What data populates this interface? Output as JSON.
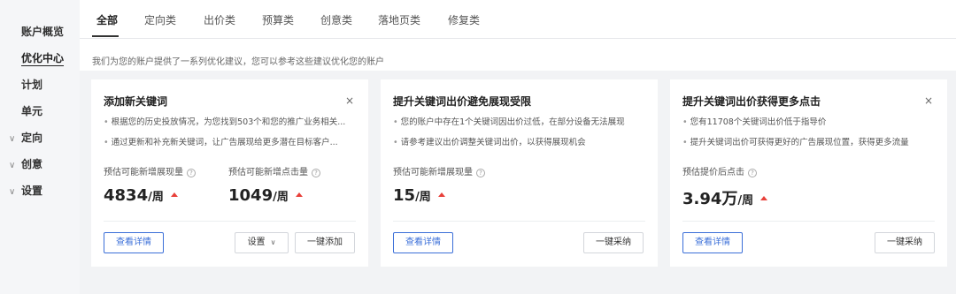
{
  "sidebar": {
    "items": [
      {
        "label": "账户概览"
      },
      {
        "label": "优化中心"
      },
      {
        "label": "计划"
      },
      {
        "label": "单元"
      },
      {
        "label": "定向",
        "chevron": "∨"
      },
      {
        "label": "创意",
        "chevron": "∨"
      },
      {
        "label": "设置",
        "chevron": "∨"
      }
    ]
  },
  "tabs": [
    "全部",
    "定向类",
    "出价类",
    "预算类",
    "创意类",
    "落地页类",
    "修复类"
  ],
  "hint": "我们为您的账户提供了一系列优化建议，您可以参考这些建议优化您的账户",
  "cards": [
    {
      "title": "添加新关键词",
      "close": "×",
      "bullets": [
        "根据您的历史投放情况，为您找到503个和您的推广业务相关...",
        "通过更新和补充新关键词，让广告展现给更多潜在目标客户..."
      ],
      "metrics": [
        {
          "label": "预估可能新增展现量",
          "value": "4834",
          "unit": "/周"
        },
        {
          "label": "预估可能新增点击量",
          "value": "1049",
          "unit": "/周"
        }
      ],
      "primary_btn": "查看详情",
      "settings_btn": "设置",
      "settings_caret": "∨",
      "action_btn": "一键添加"
    },
    {
      "title": "提升关键词出价避免展现受限",
      "close": "",
      "bullets": [
        "您的账户中存在1个关键词因出价过低，在部分设备无法展现",
        "请参考建议出价调整关键词出价，以获得展现机会"
      ],
      "metrics": [
        {
          "label": "预估可能新增展现量",
          "value": "15",
          "unit": "/周"
        }
      ],
      "primary_btn": "查看详情",
      "action_btn": "一键采纳"
    },
    {
      "title": "提升关键词出价获得更多点击",
      "close": "×",
      "bullets": [
        "您有11708个关键词出价低于指导价",
        "提升关键词出价可获得更好的广告展现位置，获得更多流量"
      ],
      "metrics": [
        {
          "label": "预估提价后点击",
          "value": "3.94万",
          "unit": "/周"
        }
      ],
      "primary_btn": "查看详情",
      "action_btn": "一键采纳"
    }
  ],
  "icons": {
    "help": "?",
    "trend": "trend-up-icon"
  },
  "colors": {
    "primary": "#3b6fd8",
    "trend_up": "#e8403a",
    "content_bg": "#f2f3f5"
  }
}
